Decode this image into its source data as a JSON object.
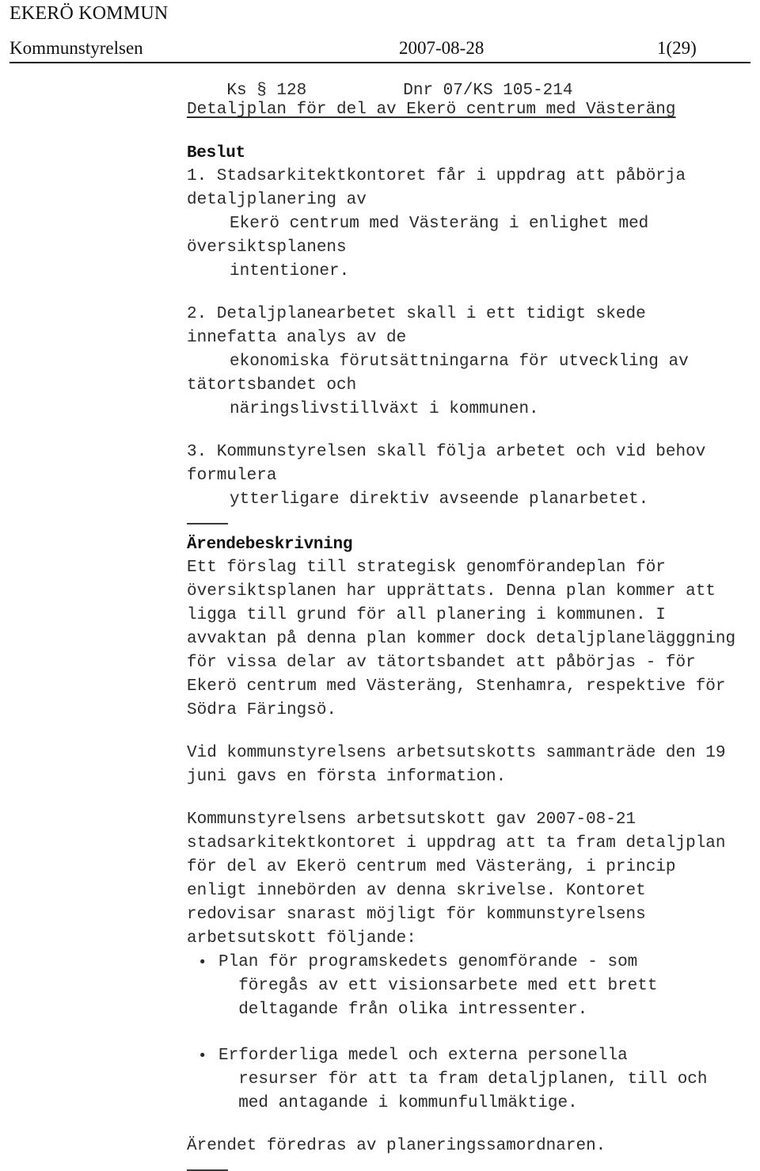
{
  "letterhead": {
    "organisation": "EKERÖ KOMMUN"
  },
  "header": {
    "unit": "Kommunstyrelsen",
    "date": "2007-08-28",
    "page": "1(29)",
    "case_number": "Ks § 128",
    "dnr": "Dnr 07/KS 105-214"
  },
  "document": {
    "title": "Detaljplan för del av Ekerö centrum med Västeräng"
  },
  "beslut": {
    "heading": "Beslut",
    "items": [
      {
        "lines": [
          {
            "text": "1. Stadsarkitektkontoret får i uppdrag att påbörja",
            "indent": false
          },
          {
            "text": "detaljplanering av",
            "indent": false
          },
          {
            "text": "Ekerö centrum med Västeräng i enlighet med",
            "indent": true
          },
          {
            "text": "översiktsplanens",
            "indent": false
          },
          {
            "text": "intentioner.",
            "indent": true
          }
        ]
      },
      {
        "lines": [
          {
            "text": "2. Detaljplanearbetet skall i ett tidigt skede",
            "indent": false
          },
          {
            "text": "innefatta analys av de",
            "indent": false
          },
          {
            "text": "ekonomiska förutsättningarna för utveckling av",
            "indent": true
          },
          {
            "text": "tätortsbandet och",
            "indent": false
          },
          {
            "text": "näringslivstillväxt i kommunen.",
            "indent": true
          }
        ]
      },
      {
        "lines": [
          {
            "text": "3. Kommunstyrelsen skall följa arbetet och vid behov",
            "indent": false
          },
          {
            "text": "formulera",
            "indent": false
          },
          {
            "text": "ytterligare direktiv avseende planarbetet.",
            "indent": true
          }
        ]
      }
    ]
  },
  "arendebeskrivning": {
    "heading": "Ärendebeskrivning",
    "paragraph1": [
      "Ett förslag till strategisk genomförandeplan för",
      "översiktsplanen har upprättats. Denna plan kommer att",
      "ligga till grund för all planering i kommunen. I",
      "avvaktan på denna plan kommer dock detaljplanelägggning",
      "för vissa delar av tätortsbandet att påbörjas - för",
      "Ekerö centrum med Västeräng, Stenhamra, respektive för",
      "Södra Färingsö."
    ],
    "paragraph2": [
      "Vid kommunstyrelsens arbetsutskotts sammanträde den 19",
      "juni gavs en första information."
    ],
    "paragraph3": [
      "Kommunstyrelsens arbetsutskott gav 2007-08-21",
      "stadsarkitektkontoret i uppdrag att ta fram detaljplan",
      "för del av Ekerö centrum med Västeräng, i princip",
      "enligt innebörden av denna skrivelse. Kontoret",
      "redovisar snarast möjligt för kommunstyrelsens",
      "arbetsutskott följande:"
    ],
    "bullets": [
      {
        "marker": "•",
        "lines": [
          "Plan för programskedets genomförande - som",
          "  föregås av ett visionsarbete med ett brett",
          "  deltagande från olika intressenter."
        ]
      },
      {
        "marker": "•",
        "lines": [
          "Erforderliga medel och externa personella",
          "  resurser för att ta fram detaljplanen, till och",
          "  med antagande i kommunfullmäktige."
        ]
      }
    ],
    "closing": "Ärendet föredras av planeringssamordnaren."
  },
  "colors": {
    "text": "#2b2b2b",
    "heading": "#101010",
    "rule": "#1a1a1a",
    "page_background": "#ffffff"
  }
}
